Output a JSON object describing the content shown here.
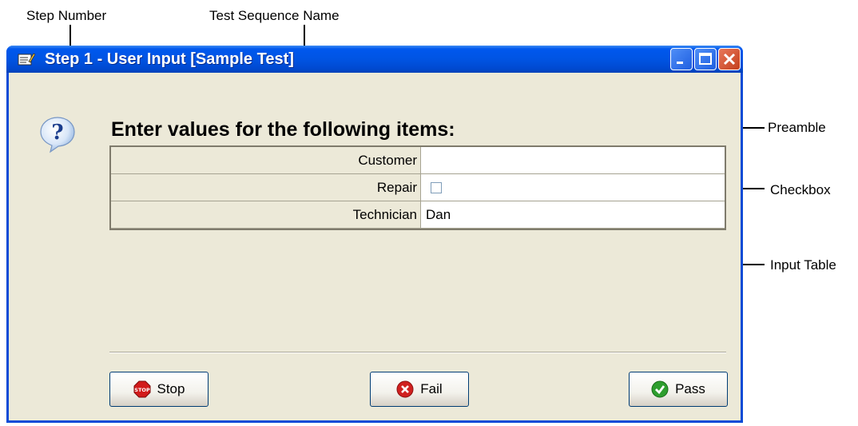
{
  "callouts": {
    "step_number": "Step Number",
    "test_sequence_name": "Test Sequence Name",
    "preamble": "Preamble",
    "checkbox": "Checkbox",
    "input_table": "Input Table"
  },
  "window": {
    "title": "Step 1 - User Input [Sample Test]",
    "icon": "edit-form-icon",
    "controls": [
      "minimize-icon",
      "maximize-icon",
      "close-icon"
    ]
  },
  "dialog": {
    "icon": "question-icon",
    "preamble": "Enter values for the following items:"
  },
  "table": {
    "rows": [
      {
        "label": "Customer",
        "value": "",
        "type": "text"
      },
      {
        "label": "Repair",
        "value": "",
        "type": "checkbox",
        "checked": false
      },
      {
        "label": "Technician",
        "value": "Dan",
        "type": "text"
      }
    ]
  },
  "buttons": {
    "stop": "Stop",
    "fail": "Fail",
    "pass": "Pass"
  },
  "colors": {
    "titlebar": "#0054E3",
    "window_bg": "#ECE9D8",
    "close_button": "#E0532C"
  }
}
